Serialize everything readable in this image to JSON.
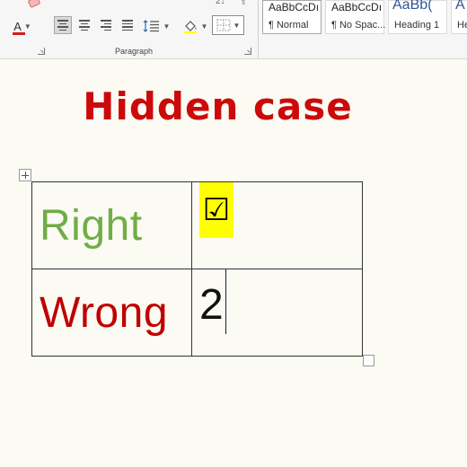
{
  "ribbon": {
    "font_color_glyph": "A",
    "font_color_bar": "#d21f1f",
    "align_active": "left",
    "paragraph_group_label": "Paragraph",
    "styles": [
      {
        "preview": "AaBbCcDı",
        "name": "¶ Normal",
        "selected": true
      },
      {
        "preview": "AaBbCcDı",
        "name": "¶ No Spac..."
      },
      {
        "preview": "AaBb(",
        "name": "Heading 1"
      },
      {
        "preview": "A",
        "name": "He"
      }
    ],
    "top_partial_1": "2↓",
    "top_partial_2": "¶"
  },
  "document": {
    "title": "Hidden case",
    "title_color": "#cc0a0a",
    "rows": [
      {
        "label": "Right",
        "label_color": "#70ad47",
        "mark": "☑",
        "mark_highlight": "#ffff00"
      },
      {
        "label": "Wrong",
        "label_color": "#c00000",
        "value": "2"
      }
    ]
  }
}
